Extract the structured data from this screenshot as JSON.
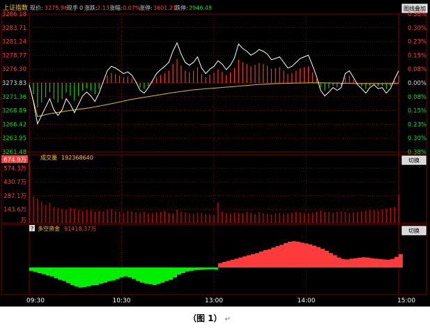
{
  "header": {
    "index_name": "上证指数",
    "price_label": "现价:",
    "price_value": "3275.96",
    "vol_label": "现手",
    "vol_value": "0",
    "change_label": "涨跌:",
    "change_value": "2.13",
    "pct_label": "涨幅:",
    "pct_value": "0.07%",
    "up_label": "涨停:",
    "up_value": "3601.21",
    "down_label": "跌停:",
    "down_value": "2946.45",
    "overlay_button": "图线叠加"
  },
  "volume_panel": {
    "label": "成交量",
    "value": "192368640",
    "switch_button": "切换",
    "highlight_label": "674.9万"
  },
  "money_panel": {
    "label": "多空资金",
    "value": "91418.37万",
    "switch_button": "切换",
    "help_icon": "?"
  },
  "caption": {
    "text": "（图 1）",
    "mark": "↵"
  },
  "colors": {
    "background": "#000000",
    "grid": "#7a0000",
    "price_line": "#ffffff",
    "avg_line": "#d8c800",
    "up": "#ff3030",
    "down": "#00d800",
    "volume": "#c00000",
    "money_positive": "#ff3a3a",
    "money_negative": "#00ee00",
    "header_text": "#ffcc00",
    "label_red": "#ff3c3c",
    "label_green": "#00e000"
  },
  "chart_data": {
    "type": "line",
    "x_ticks": [
      "09:30",
      "10:30",
      "13:00",
      "14:00",
      "15:00"
    ],
    "price_axis": {
      "labels": [
        "3286.18",
        "3283.71",
        "3281.24",
        "3278.77",
        "3276.30",
        "3273.83",
        "3271.36",
        "3268.89",
        "3266.42",
        "3263.95",
        "3261.48"
      ],
      "ylim": [
        3261.48,
        3286.18
      ],
      "prev_close": 3273.83
    },
    "pct_axis": {
      "labels": [
        "0.38%",
        "0.30%",
        "0.23%",
        "0.15%",
        "0.08%",
        "0.00%",
        "0.08%",
        "0.15%",
        "0.23%",
        "0.30%",
        "0.38%"
      ]
    },
    "volume_axis": {
      "labels": [
        "674.9万",
        "574.3万",
        "430.7万",
        "287.1万",
        "143.6万",
        "万"
      ],
      "ylim": [
        0,
        674.9
      ]
    },
    "price_series": [
      [
        0,
        3273.5
      ],
      [
        1,
        3270.5
      ],
      [
        2,
        3266.5
      ],
      [
        3,
        3268.0
      ],
      [
        4,
        3269.5
      ],
      [
        5,
        3271.0
      ],
      [
        6,
        3269.0
      ],
      [
        7,
        3268.0
      ],
      [
        8,
        3269.0
      ],
      [
        9,
        3271.0
      ],
      [
        10,
        3270.0
      ],
      [
        11,
        3268.5
      ],
      [
        12,
        3270.0
      ],
      [
        13,
        3271.5
      ],
      [
        14,
        3272.2
      ],
      [
        15,
        3271.5
      ],
      [
        16,
        3270.5
      ],
      [
        17,
        3272.0
      ],
      [
        18,
        3274.0
      ],
      [
        19,
        3276.0
      ],
      [
        20,
        3276.8
      ],
      [
        21,
        3276.5
      ],
      [
        22,
        3276.0
      ],
      [
        23,
        3275.5
      ],
      [
        24,
        3275.8
      ],
      [
        25,
        3275.2
      ],
      [
        26,
        3274.0
      ],
      [
        27,
        3272.5
      ],
      [
        28,
        3272.0
      ],
      [
        29,
        3273.0
      ],
      [
        30,
        3274.2
      ],
      [
        31,
        3275.5
      ],
      [
        32,
        3276.2
      ],
      [
        33,
        3276.8
      ],
      [
        34,
        3277.5
      ],
      [
        35,
        3279.5
      ],
      [
        36,
        3281.0
      ],
      [
        37,
        3279.0
      ],
      [
        38,
        3277.5
      ],
      [
        39,
        3277.0
      ],
      [
        40,
        3277.5
      ],
      [
        41,
        3278.5
      ],
      [
        42,
        3276.5
      ],
      [
        43,
        3275.5
      ],
      [
        44,
        3276.3
      ],
      [
        45,
        3276.8
      ],
      [
        46,
        3277.8
      ],
      [
        47,
        3277.2
      ],
      [
        48,
        3276.2
      ],
      [
        49,
        3277.0
      ],
      [
        50,
        3278.3
      ],
      [
        51,
        3280.8
      ],
      [
        52,
        3280.0
      ],
      [
        53,
        3279.5
      ],
      [
        54,
        3278.8
      ],
      [
        55,
        3279.2
      ],
      [
        56,
        3279.8
      ],
      [
        57,
        3279.5
      ],
      [
        58,
        3279.0
      ],
      [
        59,
        3278.0
      ],
      [
        60,
        3278.2
      ],
      [
        61,
        3278.5
      ],
      [
        62,
        3277.5
      ],
      [
        63,
        3276.5
      ],
      [
        64,
        3276.8
      ],
      [
        65,
        3277.5
      ],
      [
        66,
        3278.2
      ],
      [
        67,
        3278.5
      ],
      [
        68,
        3278.8
      ],
      [
        69,
        3277.0
      ],
      [
        70,
        3275.0
      ],
      [
        71,
        3272.5
      ],
      [
        72,
        3271.5
      ],
      [
        73,
        3272.2
      ],
      [
        74,
        3273.0
      ],
      [
        75,
        3272.5
      ],
      [
        76,
        3273.0
      ],
      [
        77,
        3275.5
      ],
      [
        78,
        3276.0
      ],
      [
        79,
        3274.8
      ],
      [
        80,
        3273.5
      ],
      [
        81,
        3272.8
      ],
      [
        82,
        3272.0
      ],
      [
        83,
        3273.0
      ],
      [
        84,
        3273.5
      ],
      [
        85,
        3272.8
      ],
      [
        86,
        3273.0
      ],
      [
        87,
        3272.0
      ],
      [
        88,
        3272.8
      ],
      [
        89,
        3274.5
      ],
      [
        90,
        3276.0
      ]
    ],
    "avg_series": [
      [
        0,
        3273.5
      ],
      [
        2,
        3267.8
      ],
      [
        5,
        3268.3
      ],
      [
        10,
        3268.9
      ],
      [
        15,
        3269.4
      ],
      [
        20,
        3270.1
      ],
      [
        25,
        3270.9
      ],
      [
        30,
        3271.5
      ],
      [
        35,
        3272.1
      ],
      [
        40,
        3272.6
      ],
      [
        45,
        3272.9
      ],
      [
        50,
        3273.2
      ],
      [
        55,
        3273.5
      ],
      [
        60,
        3273.7
      ],
      [
        65,
        3273.8
      ],
      [
        70,
        3273.85
      ],
      [
        75,
        3273.8
      ],
      [
        80,
        3273.7
      ],
      [
        85,
        3273.7
      ],
      [
        90,
        3273.72
      ]
    ],
    "volume_series": [
      620,
      260,
      240,
      210,
      180,
      200,
      160,
      150,
      140,
      130,
      150,
      140,
      130,
      120,
      130,
      125,
      110,
      120,
      115,
      130,
      140,
      120,
      110,
      100,
      120,
      115,
      105,
      100,
      110,
      95,
      100,
      105,
      110,
      120,
      100,
      95,
      130,
      110,
      100,
      95,
      90,
      100,
      95,
      90,
      85,
      80,
      200,
      110,
      100,
      95,
      105,
      100,
      95,
      110,
      100,
      90,
      105,
      95,
      90,
      85,
      95,
      100,
      90,
      95,
      100,
      110,
      105,
      100,
      95,
      100,
      110,
      120,
      110,
      105,
      100,
      110,
      115,
      110,
      100,
      105,
      110,
      115,
      120,
      130,
      125,
      120,
      130,
      140,
      150,
      160,
      280
    ],
    "money_series": [
      -15,
      -20,
      -25,
      -30,
      -35,
      -40,
      -48,
      -55,
      -60,
      -70,
      -78,
      -85,
      -90,
      -88,
      -84,
      -80,
      -78,
      -72,
      -68,
      -62,
      -58,
      -52,
      -45,
      -40,
      -45,
      -52,
      -60,
      -68,
      -72,
      -75,
      -78,
      -74,
      -68,
      -60,
      -55,
      -45,
      -32,
      -25,
      -18,
      -15,
      -12,
      -10,
      -9,
      -8,
      -8,
      -9,
      20,
      25,
      30,
      35,
      40,
      45,
      50,
      55,
      60,
      65,
      72,
      78,
      82,
      90,
      96,
      102,
      110,
      116,
      118,
      116,
      112,
      108,
      104,
      98,
      92,
      84,
      75,
      65,
      55,
      45,
      38,
      36,
      40,
      42,
      44,
      46,
      45,
      42,
      40,
      38,
      36,
      35,
      38,
      48,
      60
    ]
  }
}
